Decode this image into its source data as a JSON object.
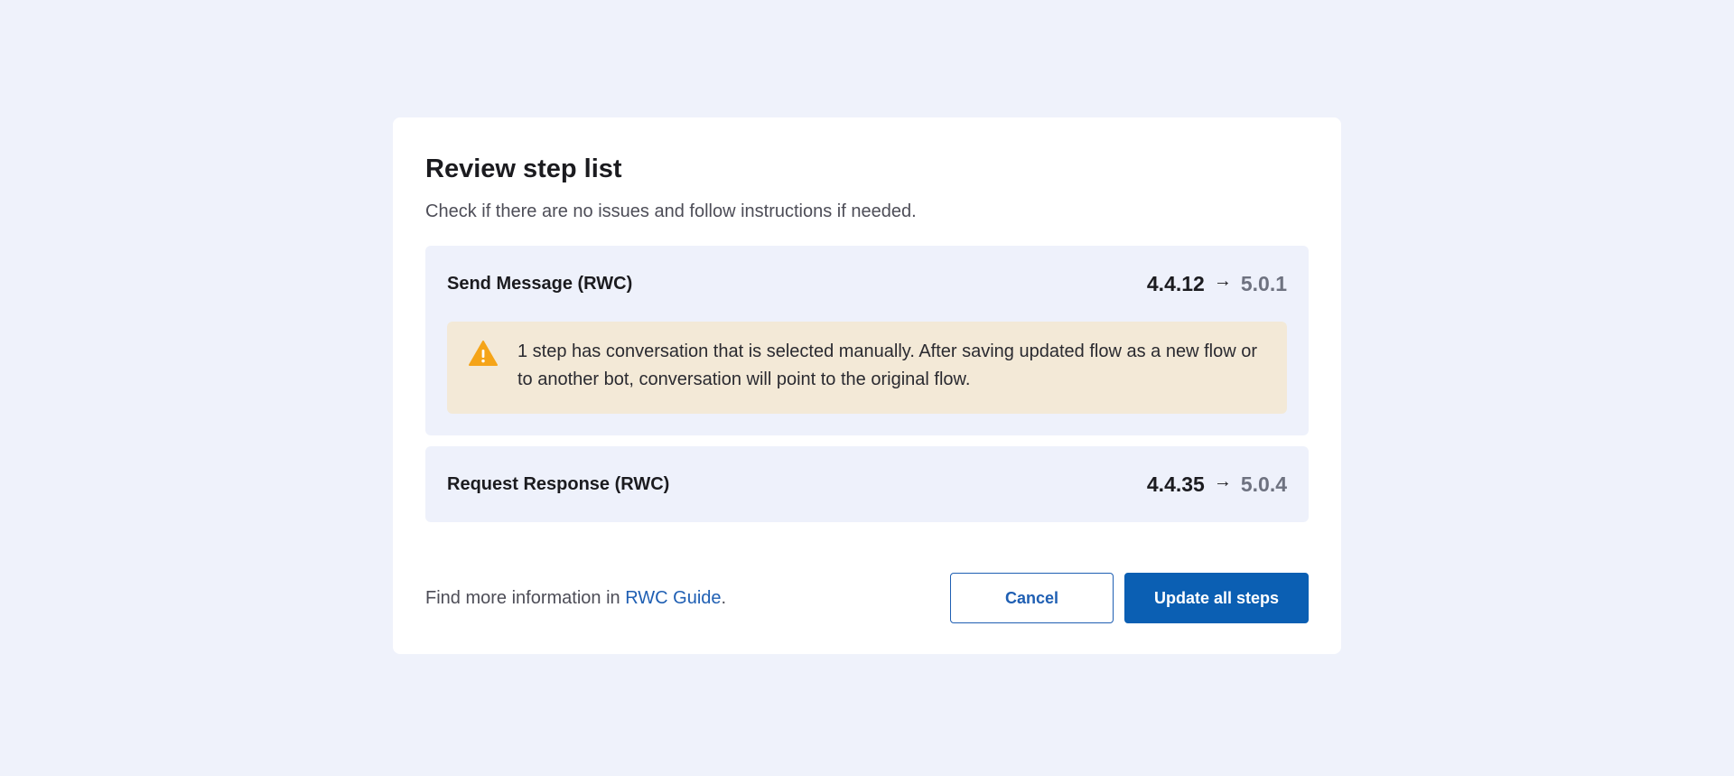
{
  "dialog": {
    "title": "Review step list",
    "subtitle": "Check if there are no issues and follow instructions if needed."
  },
  "steps": [
    {
      "name": "Send Message (RWC)",
      "version_from": "4.4.12",
      "arrow": "→",
      "version_to": "5.0.1",
      "warning": {
        "icon": "warning-triangle-icon",
        "text": "1 step has conversation that is selected manually. After saving updated flow as a new flow or to another bot, conversation will point to the original flow."
      }
    },
    {
      "name": "Request Response (RWC)",
      "version_from": "4.4.35",
      "arrow": "→",
      "version_to": "5.0.4"
    }
  ],
  "footer": {
    "info_prefix": "Find more information in ",
    "info_link": "RWC Guide",
    "info_suffix": ".",
    "cancel_label": "Cancel",
    "update_label": "Update all steps"
  },
  "colors": {
    "page_background": "#eff2fb",
    "step_background": "#eef1fb",
    "warning_background": "#f3e9d7",
    "warning_icon": "#f5a418",
    "primary": "#0b5fb3",
    "link": "#1f5fb3"
  }
}
